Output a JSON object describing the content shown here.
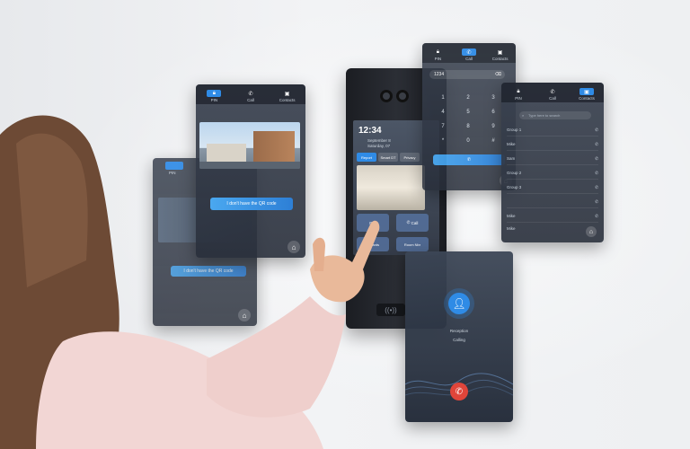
{
  "tabs": {
    "pin": "PIN",
    "call": "Call",
    "contacts": "Contacts"
  },
  "qr_panel": {
    "button_label": "I don't have the QR code"
  },
  "left_panel": {
    "button_label": "I don't have the QR code",
    "top_label": "PIN"
  },
  "keypad": {
    "number": "1234",
    "keys": [
      "1",
      "2",
      "3",
      "4",
      "5",
      "6",
      "7",
      "8",
      "9",
      "*",
      "0",
      "#"
    ]
  },
  "contacts_panel": {
    "search_placeholder": "Type here to search",
    "rows": [
      "Group 1",
      "Mike",
      "Sam",
      "Group 2",
      "Group 3",
      "",
      "Mike",
      "Mike"
    ]
  },
  "device": {
    "time": "12:34",
    "date_line": "September 8",
    "date_line2": "Saturday, 07",
    "chips": [
      "Report",
      "Smart DT",
      "Privacy"
    ],
    "tiles": [
      "PIN",
      "Call",
      "Tenants",
      "Room Nbr"
    ]
  },
  "call_panel": {
    "name": "Reception",
    "status": "Calling"
  },
  "colors": {
    "accent": "#2f8be6",
    "hangup": "#e0453a",
    "skin": "#e9b99a",
    "sleeve": "#f2d6d4",
    "hair": "#6d4a35"
  }
}
